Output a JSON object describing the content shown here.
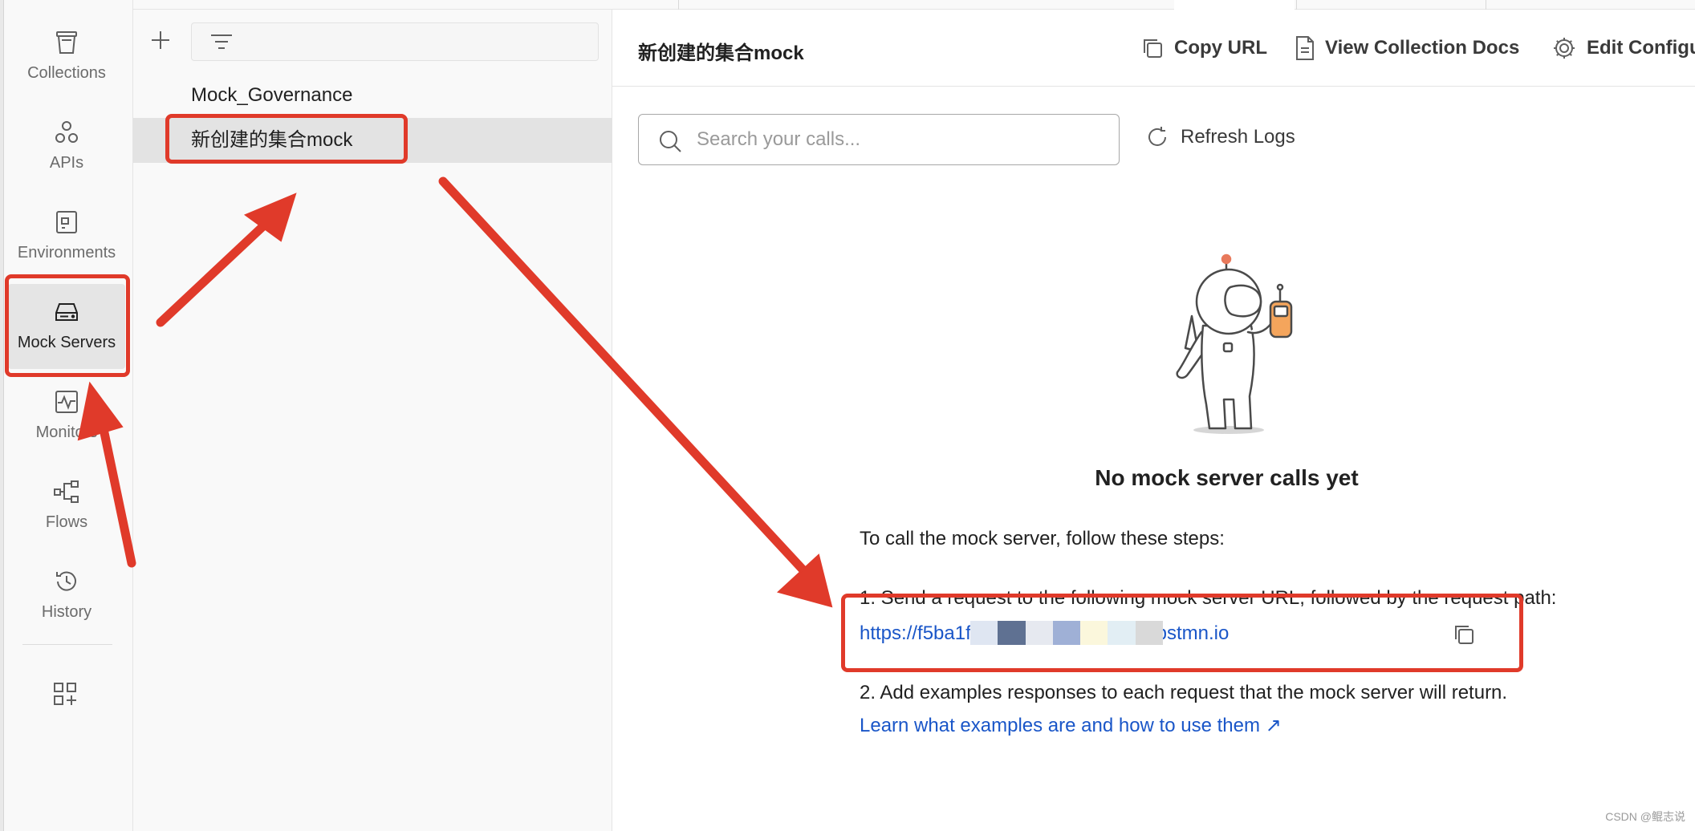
{
  "rail": {
    "items": [
      {
        "label": "Collections",
        "icon": "collections-icon"
      },
      {
        "label": "APIs",
        "icon": "apis-icon"
      },
      {
        "label": "Environments",
        "icon": "environments-icon"
      },
      {
        "label": "Mock Servers",
        "icon": "mock-servers-icon",
        "active": true
      },
      {
        "label": "Monitors",
        "icon": "monitors-icon"
      },
      {
        "label": "Flows",
        "icon": "flows-icon"
      },
      {
        "label": "History",
        "icon": "history-icon"
      }
    ],
    "apps_icon": "add-apps-icon"
  },
  "sidebar": {
    "add_icon": "plus-icon",
    "filter_icon": "filter-icon",
    "items": [
      {
        "label": "Mock_Governance"
      },
      {
        "label": "新创建的集合mock",
        "selected": true
      }
    ]
  },
  "header": {
    "title": "新创建的集合mock",
    "buttons": [
      {
        "label": "Copy URL",
        "icon": "copy-icon"
      },
      {
        "label": "View Collection Docs",
        "icon": "document-icon"
      },
      {
        "label": "Edit Configu",
        "icon": "gear-icon"
      }
    ]
  },
  "search": {
    "placeholder": "Search your calls...",
    "icon": "search-icon"
  },
  "refresh": {
    "label": "Refresh Logs",
    "icon": "refresh-icon"
  },
  "empty_state": {
    "illustration": "astronaut-with-radio",
    "title": "No mock server calls yet",
    "intro": "To call the mock server, follow these steps:",
    "step1": "1. Send a request to the following mock server URL, followed by the request path:",
    "mock_url": "https://f5ba1f                                      3a35f7d74a15.mock.pstmn.io",
    "step2": "2. Add examples responses to each request that the mock server will return.",
    "learn_link": "Learn what examples are and how to use them ↗"
  },
  "colors": {
    "annotation_red": "#e03a2a",
    "link_blue": "#1a56c8",
    "selected_gray": "#e3e3e3"
  },
  "watermark": "CSDN @鲲志说"
}
